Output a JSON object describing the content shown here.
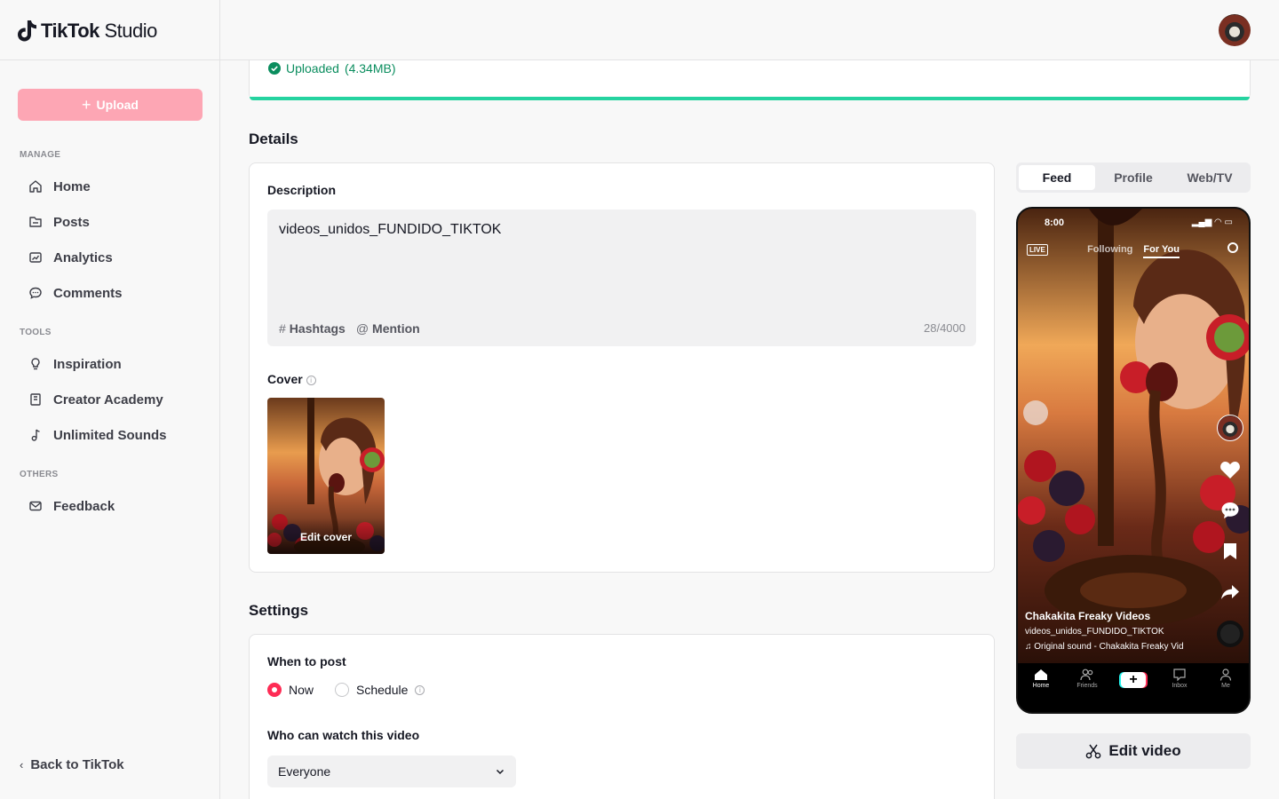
{
  "app": {
    "logo_text": "TikTok",
    "logo_sub": "Studio"
  },
  "sidebar": {
    "upload_label": "Upload",
    "sections": {
      "manage": "MANAGE",
      "tools": "TOOLS",
      "others": "OTHERS"
    },
    "items": [
      {
        "label": "Home",
        "icon": "home-icon"
      },
      {
        "label": "Posts",
        "icon": "folder-icon"
      },
      {
        "label": "Analytics",
        "icon": "chart-icon"
      },
      {
        "label": "Comments",
        "icon": "comment-icon"
      },
      {
        "label": "Inspiration",
        "icon": "lightbulb-icon"
      },
      {
        "label": "Creator Academy",
        "icon": "book-icon"
      },
      {
        "label": "Unlimited Sounds",
        "icon": "music-note-icon"
      },
      {
        "label": "Feedback",
        "icon": "mail-icon"
      }
    ],
    "back_label": "Back to TikTok"
  },
  "upload": {
    "status": "Uploaded",
    "size": "(4.34MB)",
    "progress": 1.0,
    "color": "#25d3a0"
  },
  "details": {
    "title": "Details",
    "description_label": "Description",
    "description_value": "videos_unidos_FUNDIDO_TIKTOK",
    "hashtags_label": "Hashtags",
    "mention_label": "Mention",
    "char_count": "28/4000",
    "cover_label": "Cover",
    "edit_cover_label": "Edit cover"
  },
  "settings": {
    "title": "Settings",
    "when_to_post_label": "When to post",
    "option_now": "Now",
    "option_schedule": "Schedule",
    "selected": "Now",
    "who_can_watch_label": "Who can watch this video",
    "who_can_watch_value": "Everyone"
  },
  "preview": {
    "tabs": [
      "Feed",
      "Profile",
      "Web/TV"
    ],
    "active_tab": "Feed",
    "phone": {
      "time": "8:00",
      "nav_following": "Following",
      "nav_for_you": "For You",
      "author": "Chakakita Freaky Videos",
      "caption": "videos_unidos_FUNDIDO_TIKTOK",
      "sound": "Original sound - Chakakita Freaky Vid",
      "bottom_nav": [
        "Home",
        "Friends",
        "Inbox",
        "Me"
      ]
    },
    "edit_video_label": "Edit video"
  },
  "colors": {
    "accent": "#fe2c55",
    "upload_button": "#fda6b4",
    "success": "#0a8d5e"
  }
}
